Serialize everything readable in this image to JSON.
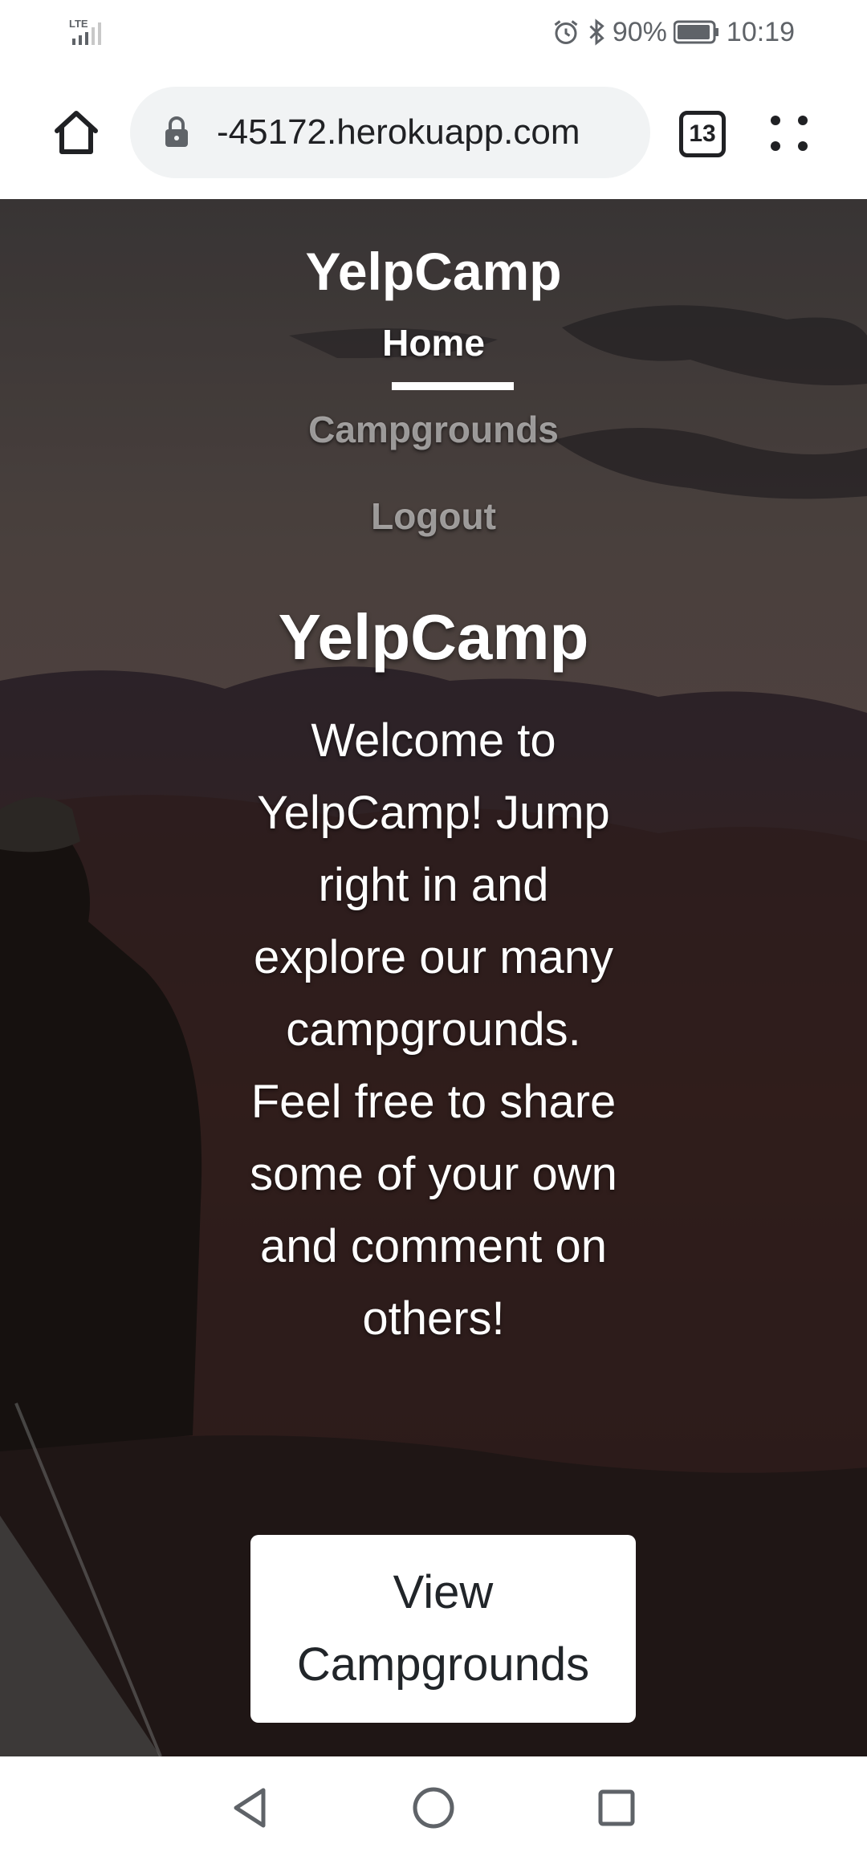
{
  "status_bar": {
    "network": "LTE",
    "battery": "90%",
    "time": "10:19"
  },
  "browser": {
    "url": "-45172.herokuapp.com",
    "tab_count": "13"
  },
  "navbar": {
    "brand": "YelpCamp",
    "links": [
      {
        "label": "Home",
        "active": true
      },
      {
        "label": "Campgrounds",
        "active": false
      },
      {
        "label": "Logout",
        "active": false
      }
    ]
  },
  "cover": {
    "title": "YelpCamp",
    "lead": "Welcome to YelpCamp! Jump right in and explore our many campgrounds. Feel free to share some of your own and comment on others!",
    "cta_label": "View Campgrounds"
  },
  "icons": {
    "home": "home-icon",
    "lock": "lock-icon",
    "menu": "more-menu-icon",
    "alarm": "alarm-icon",
    "bluetooth": "bluetooth-icon",
    "battery": "battery-icon",
    "signal": "signal-icon",
    "back": "back-icon",
    "nav_home": "circle-home-icon",
    "recents": "recents-icon"
  }
}
